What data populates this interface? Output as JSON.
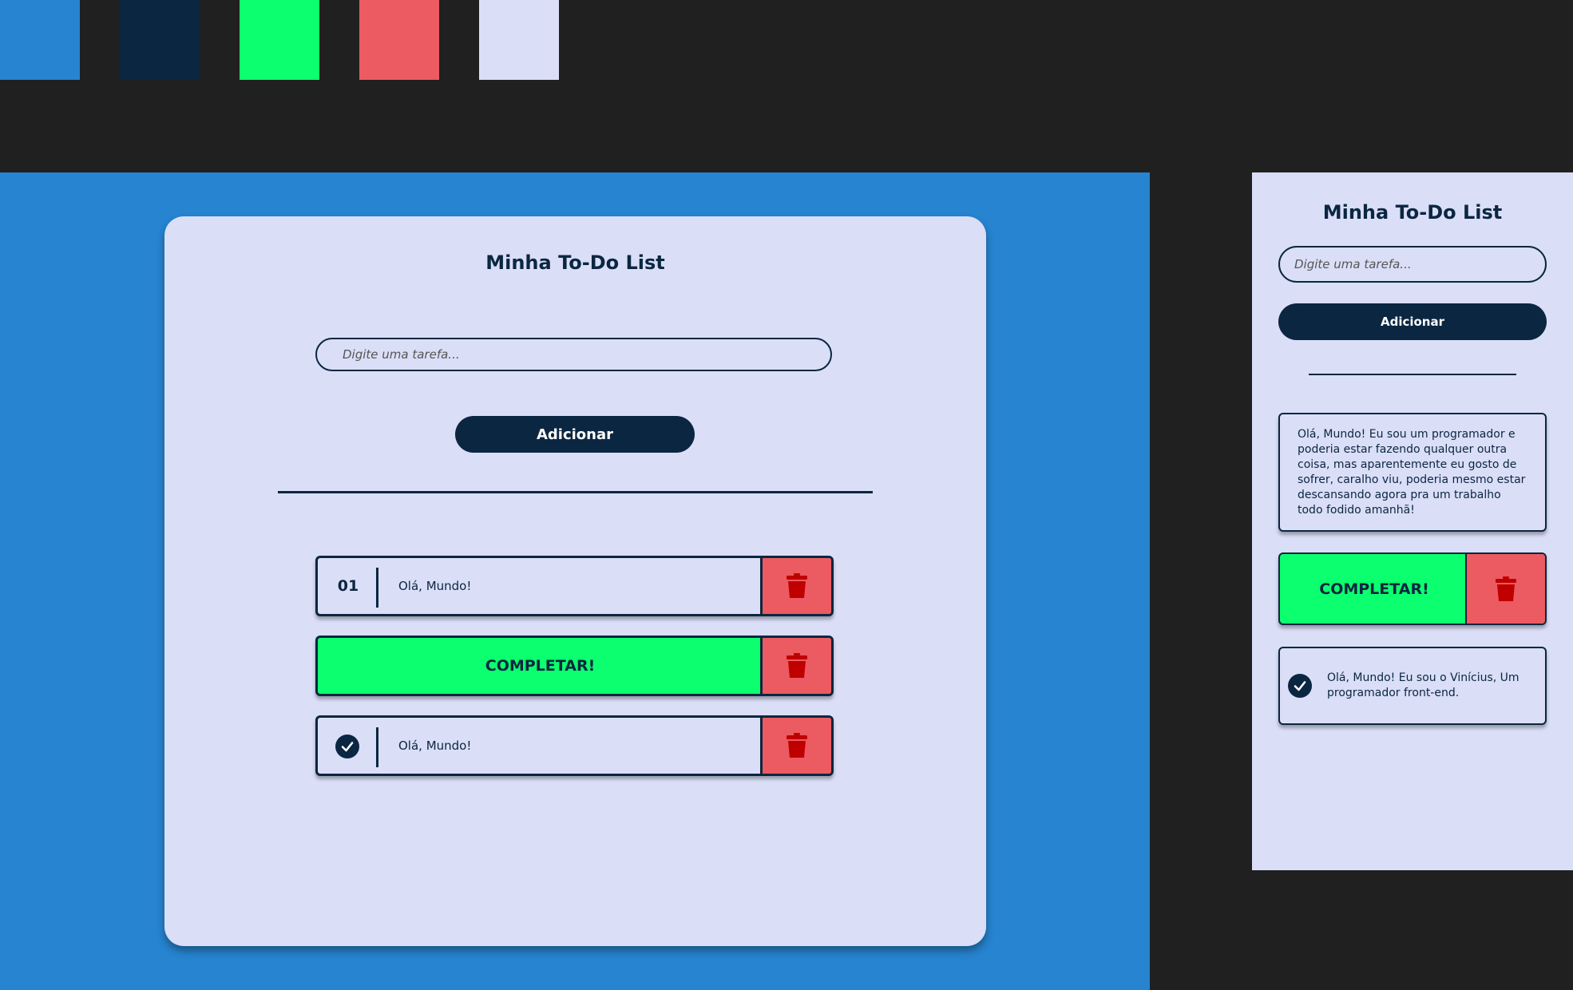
{
  "palette": {
    "colors": [
      "#2684d0",
      "#0b2640",
      "#0bff6e",
      "#eb5b61",
      "#dadef7"
    ]
  },
  "desktop": {
    "title": "Minha To-Do List",
    "input_placeholder": "Digite uma tarefa...",
    "add_label": "Adicionar",
    "tasks": [
      {
        "state": "default",
        "number": "01",
        "text": "Olá, Mundo!",
        "delete_icon": "trash-icon"
      },
      {
        "state": "hover-complete",
        "complete_label": "COMPLETAR!",
        "delete_icon": "trash-icon"
      },
      {
        "state": "done",
        "status_icon": "check-circle-icon",
        "text": "Olá, Mundo!",
        "delete_icon": "trash-icon"
      }
    ]
  },
  "mobile": {
    "title": "Minha To-Do List",
    "input_placeholder": "Digite uma tarefa...",
    "add_label": "Adicionar",
    "tasks": [
      {
        "state": "default",
        "text": "Olá, Mundo! Eu sou um programador e poderia estar fazendo qualquer outra coisa, mas aparentemente eu gosto de sofrer, caralho viu, poderia mesmo estar descansando agora pra um trabalho todo fodido amanhã!"
      },
      {
        "state": "hover-complete",
        "complete_label": "COMPLETAR!",
        "delete_icon": "trash-icon"
      },
      {
        "state": "done",
        "status_icon": "check-circle-icon",
        "text": "Olá, Mundo! Eu sou o Vinícius, Um programador front-end."
      }
    ]
  }
}
